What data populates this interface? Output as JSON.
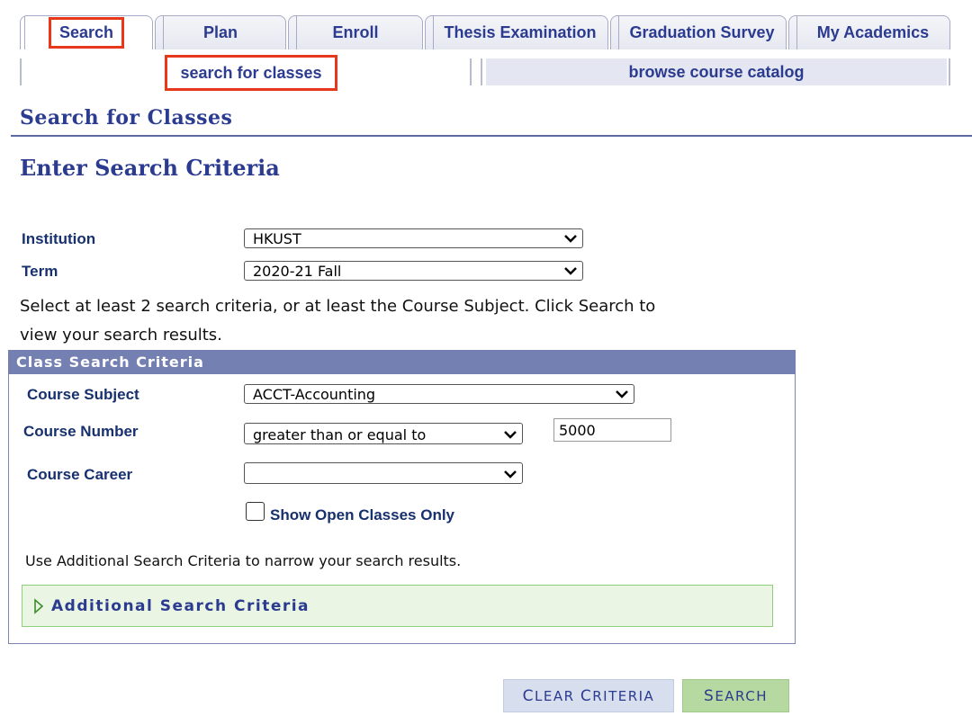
{
  "tabs": [
    "Search",
    "Plan",
    "Enroll",
    "Thesis Examination",
    "Graduation Survey",
    "My Academics"
  ],
  "subnav": {
    "left": "search for classes",
    "right": "browse course catalog"
  },
  "page": {
    "title": "Search for Classes",
    "subtitle": "Enter Search Criteria"
  },
  "institution": {
    "label": "Institution",
    "value": "HKUST"
  },
  "term": {
    "label": "Term",
    "value": "2020-21 Fall"
  },
  "instructions": {
    "line1": "Select at least 2 search criteria, or at least the Course Subject. Click Search to",
    "line2": "view your search results."
  },
  "criteria": {
    "header": "Class Search Criteria",
    "course_subject": {
      "label": "Course Subject",
      "value": "ACCT-Accounting"
    },
    "course_number": {
      "label": "Course Number",
      "operator": "greater than or equal to",
      "value": "5000"
    },
    "course_career": {
      "label": "Course Career",
      "value": ""
    },
    "open_only": {
      "label": "Show Open Classes Only",
      "checked": false
    },
    "note": "Use Additional Search Criteria to narrow your search results.",
    "additional": "Additional Search Criteria"
  },
  "buttons": {
    "clear": {
      "first": "C",
      "rest": "LEAR ",
      "first2": "C",
      "rest2": "RITERIA"
    },
    "search": {
      "first": "S",
      "rest": "EARCH"
    }
  },
  "colors": {
    "accent": "#2b3b8f",
    "header_bg": "#7580b2",
    "highlight": "#e8381c",
    "search_btn": "#b5d9a0",
    "clear_btn": "#d7deee"
  }
}
